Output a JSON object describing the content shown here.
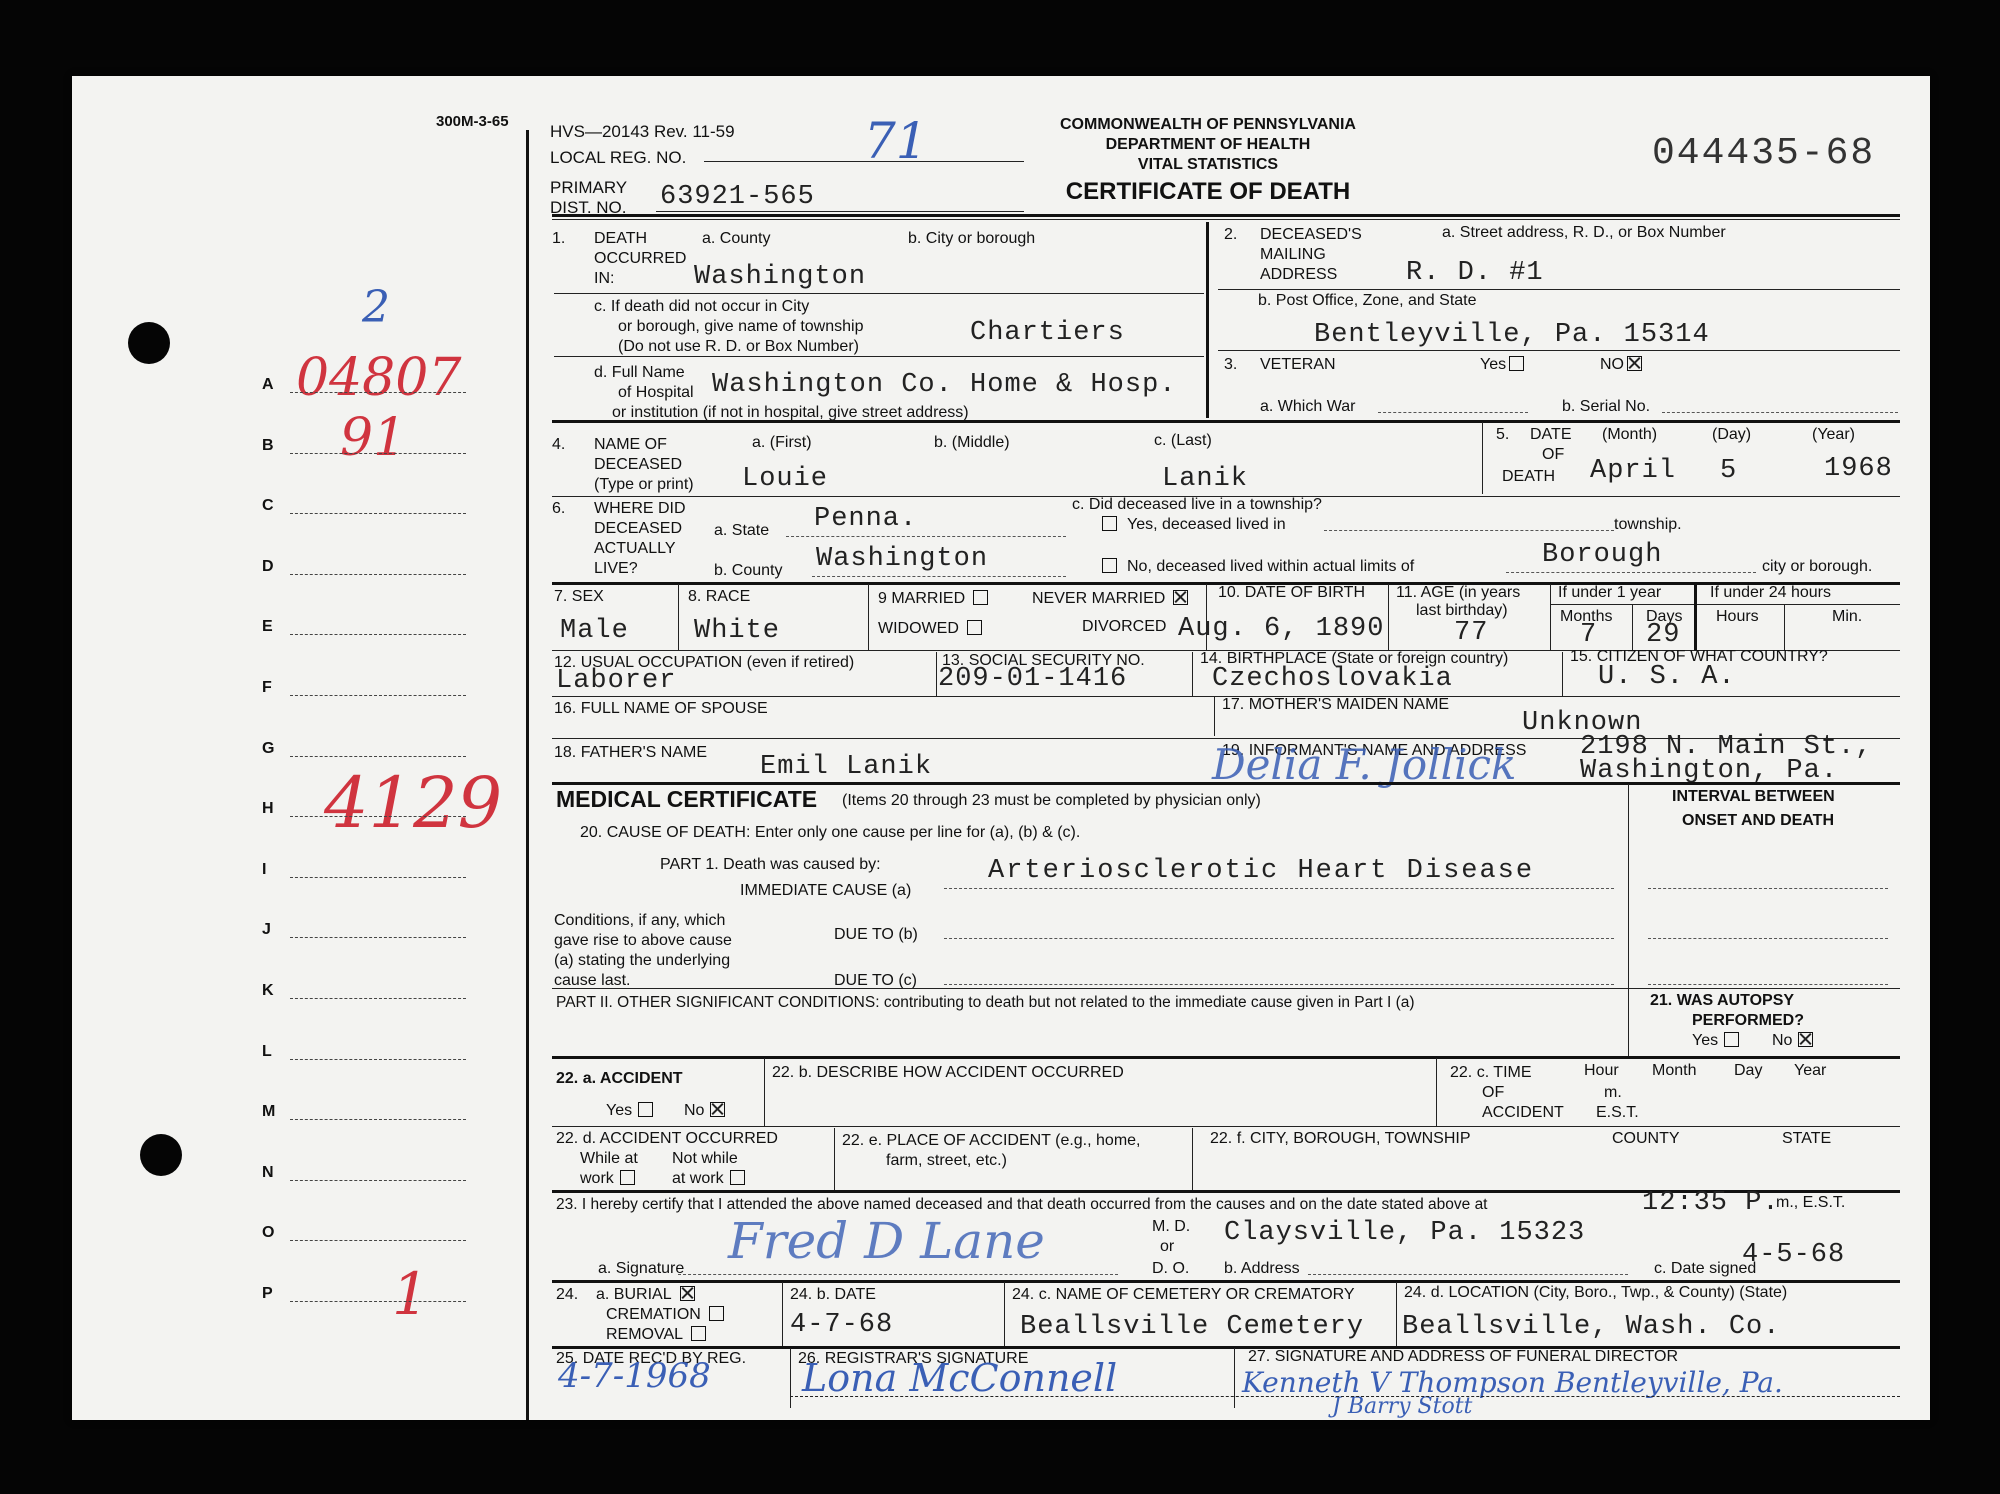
{
  "margin": {
    "form_code": "300M-3-65",
    "letters": [
      "A",
      "B",
      "C",
      "D",
      "E",
      "F",
      "G",
      "H",
      "I",
      "J",
      "K",
      "L",
      "M",
      "N",
      "O",
      "P"
    ],
    "hand_2": "2",
    "hand_A": "04807",
    "hand_B": "91",
    "hand_H": "4129",
    "hand_P": "1"
  },
  "header": {
    "form_id": "HVS—20143 Rev. 11-59",
    "local_reg_label": "LOCAL REG. NO.",
    "local_reg_value": "71",
    "primary_label": "PRIMARY",
    "dist_label": "DIST. NO.",
    "dist_value": "63921-565",
    "agency_1": "COMMONWEALTH OF PENNSYLVANIA",
    "agency_2": "DEPARTMENT OF HEALTH",
    "agency_3": "VITAL STATISTICS",
    "title": "CERTIFICATE OF DEATH",
    "cert_number": "044435-68"
  },
  "f1": {
    "num": "1.",
    "death": "DEATH",
    "occurred": "OCCURRED",
    "in": "IN:",
    "county_label": "a. County",
    "county_value": "Washington",
    "city_label": "b. City or borough",
    "c_line1": "c. If death did not occur in City",
    "c_line2": "or borough, give name of township",
    "c_line3": "(Do not use R. D. or Box Number)",
    "township_value": "Chartiers",
    "d_line1": "d. Full Name",
    "d_line2": "of Hospital",
    "d_line3": "or institution (if not in hospital, give street address)",
    "hospital_value": "Washington Co. Home & Hosp."
  },
  "f2": {
    "num": "2.",
    "l1": "DECEASED'S",
    "l2": "MAILING",
    "l3": "ADDRESS",
    "street_label": "a. Street address, R. D., or Box Number",
    "street_value": "R. D. #1",
    "po_label": "b. Post Office, Zone, and State",
    "po_value": "Bentleyville, Pa. 15314"
  },
  "f3": {
    "num": "3.",
    "label": "VETERAN",
    "yes": "Yes",
    "no": "NO",
    "war_label": "a. Which War",
    "serial_label": "b. Serial No."
  },
  "f4": {
    "num": "4.",
    "l1": "NAME OF",
    "l2": "DECEASED",
    "l3": "(Type or print)",
    "first_label": "a. (First)",
    "middle_label": "b. (Middle)",
    "last_label": "c. (Last)",
    "first_value": "Louie",
    "last_value": "Lanik"
  },
  "f5": {
    "num": "5.",
    "l1": "DATE",
    "l2": "OF",
    "l3": "DEATH",
    "month_label": "(Month)",
    "day_label": "(Day)",
    "year_label": "(Year)",
    "month_value": "April",
    "day_value": "5",
    "year_value": "1968"
  },
  "f6": {
    "num": "6.",
    "l1": "WHERE DID",
    "l2": "DECEASED",
    "l3": "ACTUALLY",
    "l4": "LIVE?",
    "state_label": "a. State",
    "state_value": "Penna.",
    "county_label": "b. County",
    "county_value": "Washington",
    "c_label": "c. Did deceased live in a township?",
    "yes_text": "Yes, deceased lived in",
    "township_word": "township.",
    "no_text": "No, deceased lived within actual limits of",
    "borough_value": "Borough",
    "city_word": "city or borough."
  },
  "f7": {
    "label": "7. SEX",
    "value": "Male"
  },
  "f8": {
    "label": "8. RACE",
    "value": "White"
  },
  "f9": {
    "married": "9 MARRIED",
    "never": "NEVER MARRIED",
    "widowed": "WIDOWED",
    "divorced": "DIVORCED"
  },
  "f10": {
    "label": "10. DATE OF BIRTH",
    "value": "Aug. 6, 1890"
  },
  "f11": {
    "label": "11. AGE (in years",
    "label2": "last birthday)",
    "value": "77",
    "u1": "If under 1 year",
    "months": "Months",
    "days": "Days",
    "months_value": "7",
    "days_value": "29",
    "u24": "If under 24 hours",
    "hours": "Hours",
    "min": "Min."
  },
  "f12": {
    "label": "12. USUAL OCCUPATION (even if retired)",
    "value": "Laborer"
  },
  "f13": {
    "label": "13. SOCIAL SECURITY NO.",
    "value": "209-01-1416"
  },
  "f14": {
    "label": "14. BIRTHPLACE (State or foreign country)",
    "value": "Czechoslovakia"
  },
  "f15": {
    "label": "15. CITIZEN OF WHAT COUNTRY?",
    "value": "U. S. A."
  },
  "f16": {
    "label": "16. FULL NAME OF SPOUSE"
  },
  "f17": {
    "label": "17. MOTHER'S MAIDEN NAME",
    "value": "Unknown"
  },
  "f18": {
    "label": "18. FATHER'S NAME",
    "value": "Emil Lanik"
  },
  "f19": {
    "label": "19. INFORMANT'S NAME AND ADDRESS",
    "addr1": "2198 N. Main St.,",
    "addr2": "Washington, Pa.",
    "signature": "Delia F. Jollick"
  },
  "medical": {
    "title": "MEDICAL CERTIFICATE",
    "note": "(Items 20 through 23 must be completed by physician only)",
    "interval1": "INTERVAL BETWEEN",
    "interval2": "ONSET AND DEATH",
    "f20": "20.  CAUSE OF DEATH: Enter only one cause per line for (a), (b) & (c).",
    "part1": "PART 1.  Death was caused by:",
    "immediate": "IMMEDIATE  CAUSE  (a)",
    "cause_a": "Arteriosclerotic Heart Disease",
    "cond1": "Conditions, if any, which",
    "cond2": "gave rise to above cause",
    "cond3": "(a) stating the underlying",
    "cond4": "cause last.",
    "due_b": "DUE TO (b)",
    "due_c": "DUE TO (c)",
    "part2": "PART II. OTHER SIGNIFICANT CONDITIONS: contributing to death but not related to the immediate cause given in Part I (a)",
    "f21": "21.   WAS AUTOPSY",
    "performed": "PERFORMED?",
    "yes": "Yes",
    "no": "No"
  },
  "f22": {
    "a_label": "22. a. ACCIDENT",
    "yes": "Yes",
    "no": "No",
    "b_label": "22. b. DESCRIBE HOW ACCIDENT OCCURRED",
    "c_label": "22. c. TIME",
    "c_of": "OF",
    "c_acc": "ACCIDENT",
    "hour": "Hour",
    "m": "m.",
    "est": "E.S.T.",
    "month": "Month",
    "day": "Day",
    "year": "Year",
    "d_label": "22. d. ACCIDENT OCCURRED",
    "while": "While at",
    "work": "work",
    "notwhile": "Not while",
    "atwork": "at work",
    "e_label": "22. e. PLACE OF ACCIDENT (e.g., home,",
    "e_label2": "farm, street, etc.)",
    "f_label": "22. f. CITY, BOROUGH, TOWNSHIP",
    "county": "COUNTY",
    "state": "STATE"
  },
  "f23": {
    "text": "23.  I hereby certify that I attended the above named deceased and that death occurred from the causes and on the date stated above at",
    "time_value": "12:35 P.",
    "time_suffix": "m., E.S.T.",
    "sig_label": "a. Signature",
    "md": "M. D.",
    "or": "or",
    "do": "D. O.",
    "address_label": "b. Address",
    "address_value": "Claysville, Pa. 15323",
    "date_label": "c. Date signed",
    "date_value": "4-5-68",
    "signature": "Fred D Lane"
  },
  "f24": {
    "a_num": "24.",
    "burial": "a. BURIAL",
    "cremation": "CREMATION",
    "removal": "REMOVAL",
    "b_label": "24. b. DATE",
    "b_value": "4-7-68",
    "c_label": "24. c. NAME OF CEMETERY OR CREMATORY",
    "c_value": "Beallsville Cemetery",
    "d_label": "24. d. LOCATION (City, Boro., Twp., & County) (State)",
    "d_value": "Beallsville, Wash. Co."
  },
  "f25": {
    "label": "25. DATE REC'D BY REG.",
    "value": "4-7-1968"
  },
  "f26": {
    "label": "26. REGISTRAR'S SIGNATURE",
    "value": "Lona McConnell"
  },
  "f27": {
    "label": "27. SIGNATURE AND ADDRESS OF FUNERAL DIRECTOR",
    "value1": "Kenneth V Thompson  Bentleyville, Pa.",
    "value2": "J Barry Stott"
  }
}
